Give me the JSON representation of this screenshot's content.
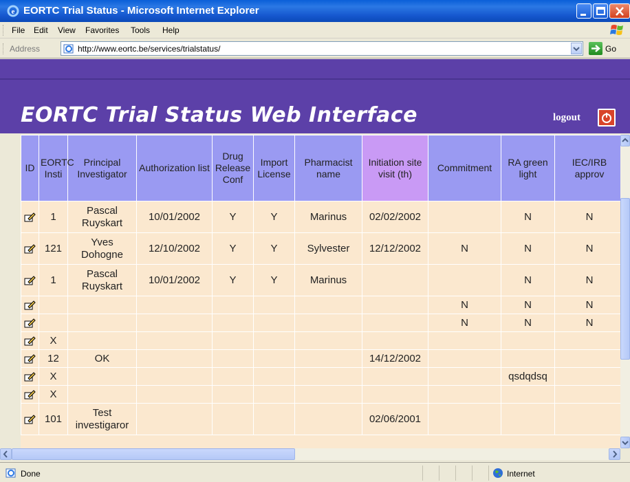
{
  "window": {
    "title": "EORTC Trial Status - Microsoft Internet Explorer"
  },
  "menu": [
    "File",
    "Edit",
    "View",
    "Favorites",
    "Tools",
    "Help"
  ],
  "address": {
    "label": "Address",
    "url": "http://www.eortc.be/services/trialstatus/",
    "go_label": "Go"
  },
  "page": {
    "title": "EORTC Trial Status Web Interface",
    "logout_label": "logout"
  },
  "table": {
    "columns": [
      "ID",
      "EORTC Insti",
      "Principal Investigator",
      "Authorization list",
      "Drug Release Conf",
      "Import License",
      "Pharmacist name",
      "Initiation site visit (th)",
      "Commitment",
      "RA green light",
      "IEC/IRB approv"
    ],
    "rows": [
      {
        "insti": "1",
        "pi": "Pascal Ruyskart",
        "auth": "10/01/2002",
        "drug": "Y",
        "import": "Y",
        "pharm": "Marinus",
        "init": "02/02/2002",
        "commit": "",
        "ra": "N",
        "iec": "N"
      },
      {
        "insti": "121",
        "pi": "Yves Dohogne",
        "auth": "12/10/2002",
        "drug": "Y",
        "import": "Y",
        "pharm": "Sylvester",
        "init": "12/12/2002",
        "commit": "N",
        "ra": "N",
        "iec": "N"
      },
      {
        "insti": "1",
        "pi": "Pascal Ruyskart",
        "auth": "10/01/2002",
        "drug": "Y",
        "import": "Y",
        "pharm": "Marinus",
        "init": "",
        "commit": "",
        "ra": "N",
        "iec": "N"
      },
      {
        "insti": "",
        "pi": "",
        "auth": "",
        "drug": "",
        "import": "",
        "pharm": "",
        "init": "",
        "commit": "N",
        "ra": "N",
        "iec": "N"
      },
      {
        "insti": "",
        "pi": "",
        "auth": "",
        "drug": "",
        "import": "",
        "pharm": "",
        "init": "",
        "commit": "N",
        "ra": "N",
        "iec": "N"
      },
      {
        "insti": "X",
        "pi": "",
        "auth": "",
        "drug": "",
        "import": "",
        "pharm": "",
        "init": "",
        "commit": "",
        "ra": "",
        "iec": ""
      },
      {
        "insti": "12",
        "pi": "OK",
        "auth": "",
        "drug": "",
        "import": "",
        "pharm": "",
        "init": "14/12/2002",
        "commit": "",
        "ra": "",
        "iec": ""
      },
      {
        "insti": "X",
        "pi": "",
        "auth": "",
        "drug": "",
        "import": "",
        "pharm": "",
        "init": "",
        "commit": "",
        "ra": "qsdqdsq",
        "iec": ""
      },
      {
        "insti": "X",
        "pi": "",
        "auth": "",
        "drug": "",
        "import": "",
        "pharm": "",
        "init": "",
        "commit": "",
        "ra": "",
        "iec": ""
      },
      {
        "insti": "101",
        "pi": "Test investigaror",
        "auth": "",
        "drug": "",
        "import": "",
        "pharm": "",
        "init": "02/06/2001",
        "commit": "",
        "ra": "",
        "iec": ""
      }
    ]
  },
  "status": {
    "text": "Done",
    "zone": "Internet"
  },
  "colors": {
    "header_bg": "#5c40a8",
    "column_header": "#9a9af2",
    "highlight_header": "#c99af5",
    "cell_bg": "#fbe8cf"
  }
}
